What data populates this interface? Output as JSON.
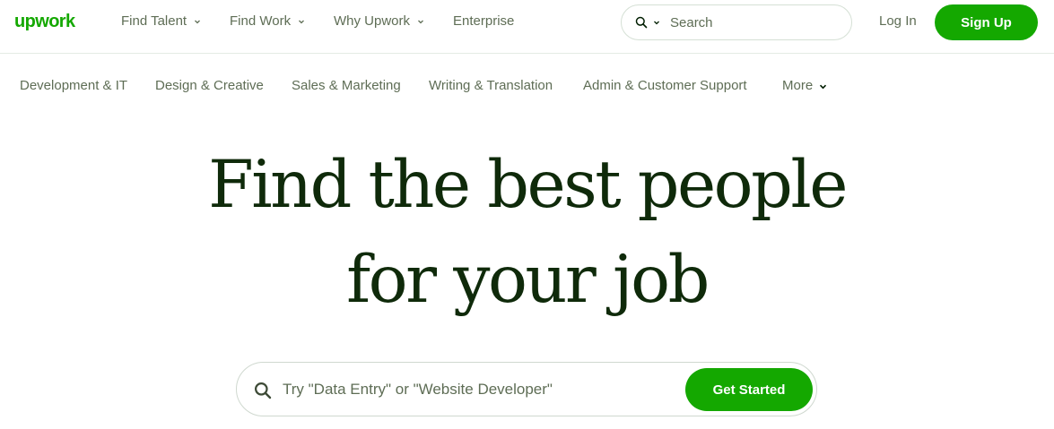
{
  "header": {
    "logo": "upwork",
    "nav": [
      {
        "label": "Find Talent",
        "has_dropdown": true
      },
      {
        "label": "Find Work",
        "has_dropdown": true
      },
      {
        "label": "Why Upwork",
        "has_dropdown": true
      },
      {
        "label": "Enterprise",
        "has_dropdown": false
      }
    ],
    "search": {
      "placeholder": "Search",
      "icon": "search-icon"
    },
    "login": "Log In",
    "signup": "Sign Up"
  },
  "categories": {
    "items": [
      "Development & IT",
      "Design & Creative",
      "Sales & Marketing",
      "Writing & Translation",
      "Admin & Customer Support"
    ],
    "more": "More"
  },
  "hero": {
    "line1": "Find the best people",
    "line2": "for your job",
    "search_placeholder": "Try \"Data Entry\" or \"Website Developer\"",
    "cta": "Get Started"
  },
  "colors": {
    "brand": "#14a800",
    "text_muted": "#5e6d55",
    "heading": "#0f2a0a"
  }
}
